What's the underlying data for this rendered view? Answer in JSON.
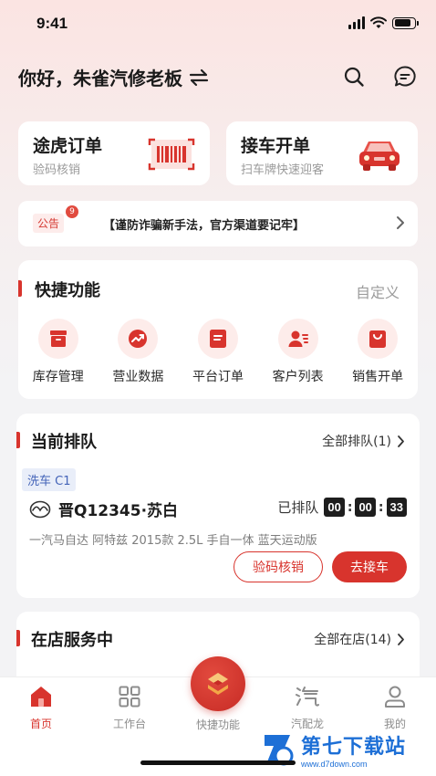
{
  "status_bar": {
    "time": "9:41",
    "battery_level": 0.85
  },
  "header": {
    "greeting": "你好，朱雀汽修老板",
    "icons": [
      "switch-icon",
      "search-icon",
      "message-icon"
    ]
  },
  "cards": [
    {
      "title": "途虎订单",
      "subtitle": "验码核销",
      "icon": "barcode-scan-icon"
    },
    {
      "title": "接车开单",
      "subtitle": "扫车牌快速迎客",
      "icon": "red-car-icon"
    }
  ],
  "notice": {
    "tag": "公告",
    "badge": "9",
    "text": "【谨防诈骗新手法，官方渠道要记牢】"
  },
  "shortcuts": {
    "title": "快捷功能",
    "customize": "自定义",
    "items": [
      {
        "label": "库存管理",
        "icon": "inventory-icon"
      },
      {
        "label": "营业数据",
        "icon": "trend-chart-icon"
      },
      {
        "label": "平台订单",
        "icon": "order-doc-icon"
      },
      {
        "label": "客户列表",
        "icon": "customer-list-icon"
      },
      {
        "label": "销售开单",
        "icon": "shopping-bag-icon"
      }
    ]
  },
  "queue": {
    "title": "当前排队",
    "more": "全部排队(1)",
    "service_tag": "洗车 C1",
    "plate": "晋Q12345·苏白",
    "brand_icon": "mazda-logo-icon",
    "status": "已排队",
    "timer": [
      "00",
      "00",
      "33"
    ],
    "car_desc": "一汽马自达 阿特兹 2015款 2.5L 手自一体 蓝天运动版",
    "btn_verify": "验码核销",
    "btn_pickup": "去接车"
  },
  "in_store": {
    "title": "在店服务中",
    "more": "全部在店(14)"
  },
  "tabbar": {
    "tabs": [
      {
        "label": "首页",
        "icon": "home-icon",
        "active": true
      },
      {
        "label": "工作台",
        "icon": "grid-icon",
        "active": false
      },
      {
        "label": "快捷功能",
        "icon": "shortcut-icon",
        "active": false
      },
      {
        "label": "汽配龙",
        "icon": "parts-icon",
        "active": false
      },
      {
        "label": "我的",
        "icon": "profile-icon",
        "active": false
      }
    ]
  },
  "watermark": {
    "title": "第七下载站",
    "url": "www.d7down.com"
  },
  "colors": {
    "accent": "#d8342d",
    "tag_blue": "#4464b8",
    "watermark_blue": "#1d6fd6"
  }
}
